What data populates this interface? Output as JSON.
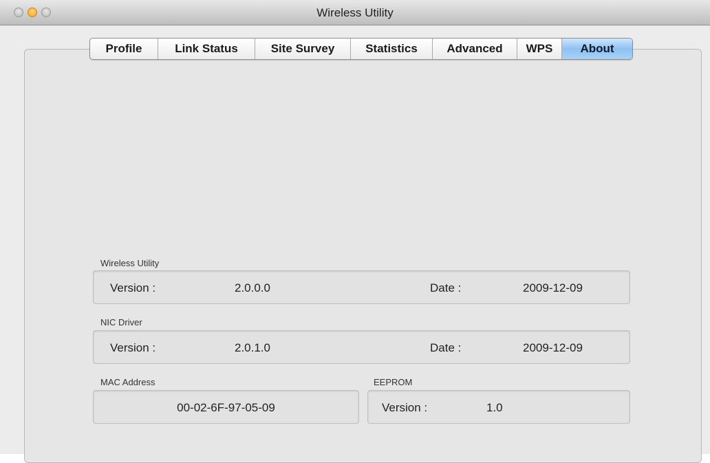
{
  "window": {
    "title": "Wireless Utility"
  },
  "tabs": [
    {
      "label": "Profile"
    },
    {
      "label": "Link Status"
    },
    {
      "label": "Site Survey"
    },
    {
      "label": "Statistics"
    },
    {
      "label": "Advanced"
    },
    {
      "label": "WPS"
    },
    {
      "label": "About",
      "active": true
    }
  ],
  "about": {
    "wireless_utility": {
      "group_label": "Wireless Utility",
      "version_label": "Version :",
      "version_value": "2.0.0.0",
      "date_label": "Date :",
      "date_value": "2009-12-09"
    },
    "nic_driver": {
      "group_label": "NIC Driver",
      "version_label": "Version :",
      "version_value": "2.0.1.0",
      "date_label": "Date :",
      "date_value": "2009-12-09"
    },
    "mac_address": {
      "group_label": "MAC Address",
      "value": "00-02-6F-97-05-09"
    },
    "eeprom": {
      "group_label": "EEPROM",
      "version_label": "Version :",
      "version_value": "1.0"
    }
  },
  "colors": {
    "active_tab": "#8fc1f2",
    "window_bg": "#ececec",
    "close_button": "#b5b5b5",
    "minimize_button": "#f5a623"
  },
  "icons": {
    "close": "close-button-icon",
    "minimize": "minimize-button-icon",
    "zoom": "zoom-button-icon"
  }
}
